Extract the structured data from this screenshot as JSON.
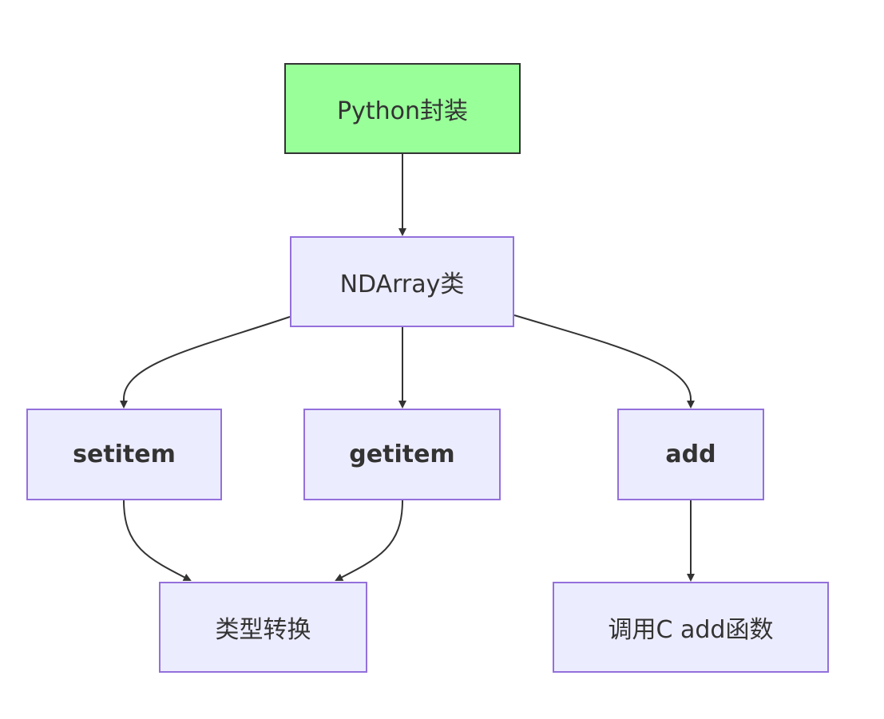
{
  "diagram": {
    "nodes": {
      "python": "Python封装",
      "ndarray": "NDArray类",
      "setitem": "setitem",
      "getitem": "getitem",
      "add": "add",
      "convert": "类型转换",
      "cadd": "调用C add函数"
    },
    "edges": [
      {
        "from": "python",
        "to": "ndarray"
      },
      {
        "from": "ndarray",
        "to": "setitem"
      },
      {
        "from": "ndarray",
        "to": "getitem"
      },
      {
        "from": "ndarray",
        "to": "add"
      },
      {
        "from": "setitem",
        "to": "convert"
      },
      {
        "from": "getitem",
        "to": "convert"
      },
      {
        "from": "add",
        "to": "cadd"
      }
    ],
    "colors": {
      "root_fill": "#99FF99",
      "node_fill": "#ECECFF",
      "node_border": "#9370DB",
      "edge": "#333333"
    }
  }
}
